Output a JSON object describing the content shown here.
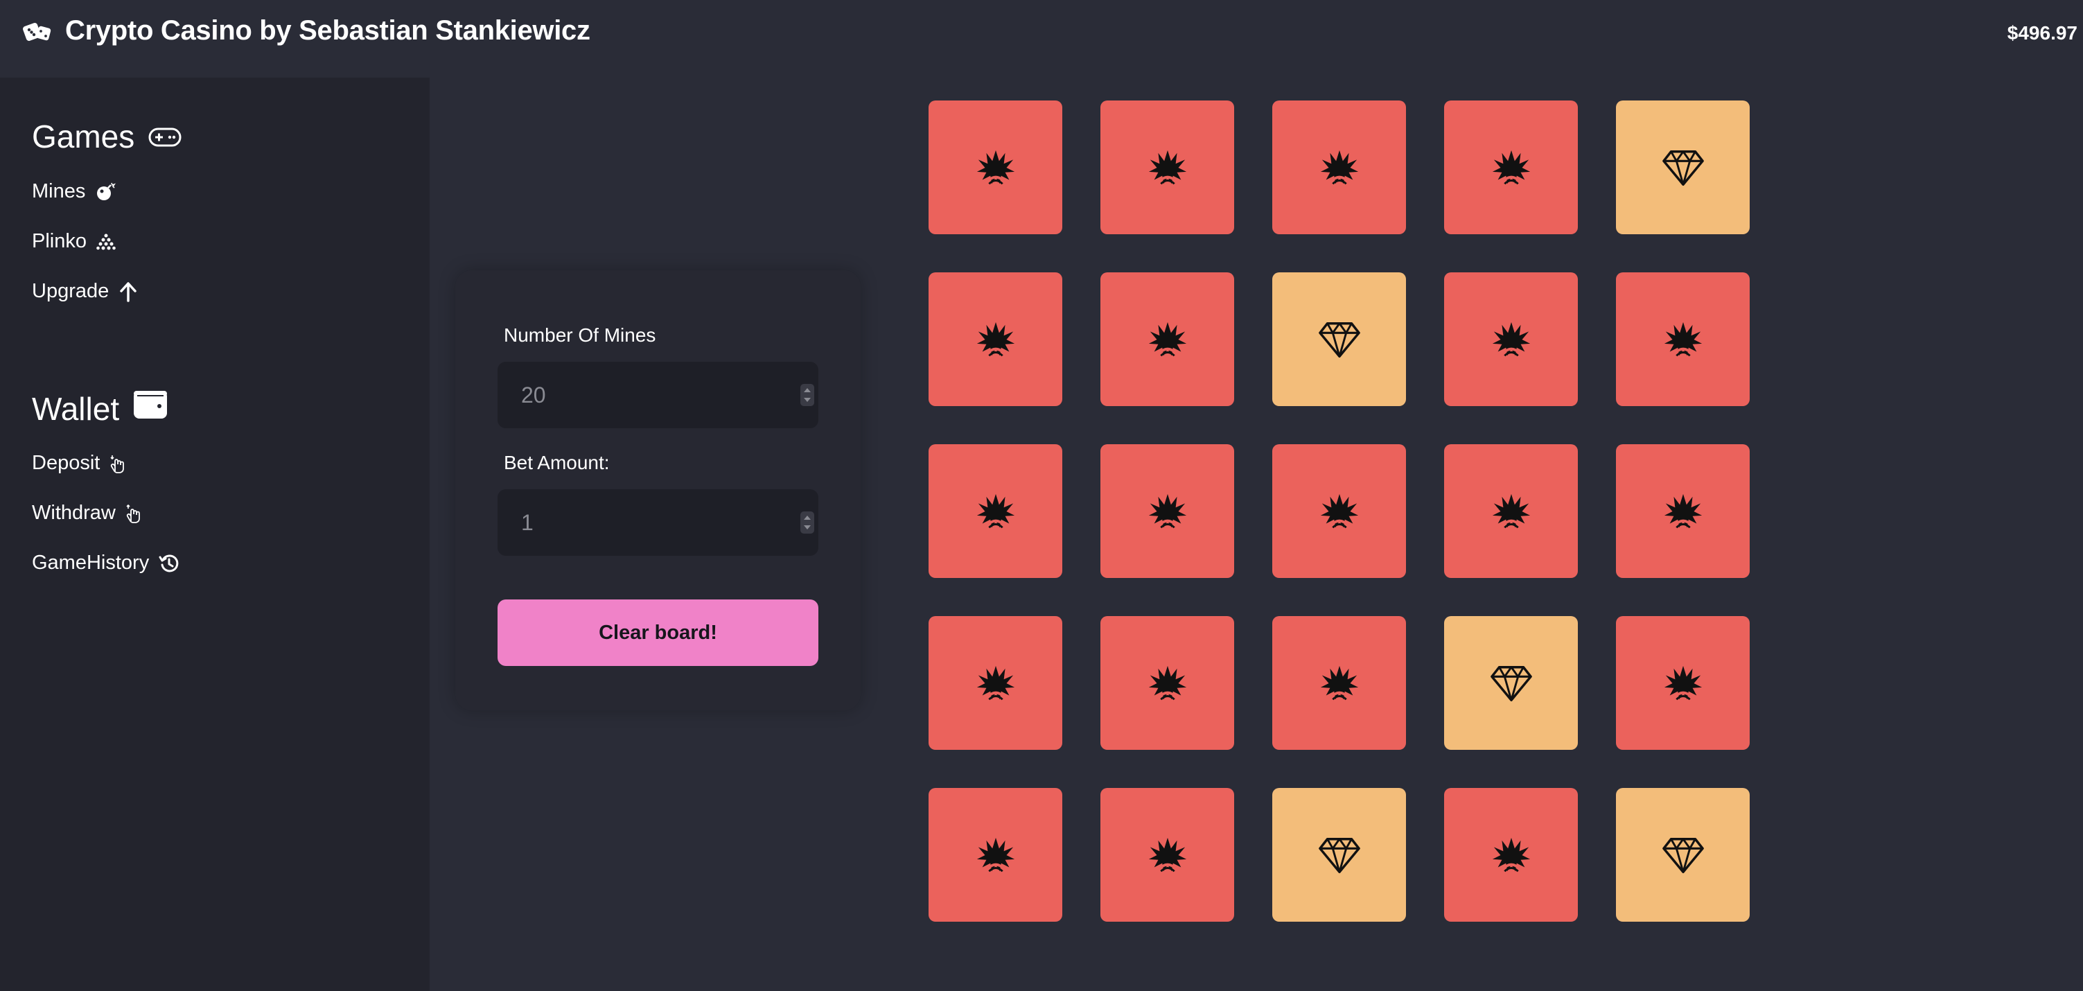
{
  "app": {
    "title": "Crypto Casino by Sebastian Stankiewicz",
    "balance": "$496.97",
    "brand_icon": "dice-icon"
  },
  "sidebar": {
    "games_heading": "Games",
    "games_icon": "gamepad-icon",
    "games": [
      {
        "label": "Mines",
        "icon": "bomb-icon"
      },
      {
        "label": "Plinko",
        "icon": "pyramid-icon"
      },
      {
        "label": "Upgrade",
        "icon": "arrow-up-icon"
      }
    ],
    "wallet_heading": "Wallet",
    "wallet_icon": "wallet-icon",
    "wallet": [
      {
        "label": "Deposit",
        "icon": "deposit-hand-icon"
      },
      {
        "label": "Withdraw",
        "icon": "withdraw-hand-icon"
      },
      {
        "label": "GameHistory",
        "icon": "history-icon"
      }
    ]
  },
  "controls": {
    "mines_label": "Number Of Mines",
    "mines_value": "20",
    "bet_label": "Bet Amount:",
    "bet_value": "1",
    "clear_button": "Clear board!"
  },
  "board": {
    "rows": [
      [
        "mine",
        "mine",
        "mine",
        "mine",
        "gem"
      ],
      [
        "mine",
        "mine",
        "gem",
        "mine",
        "mine"
      ],
      [
        "mine",
        "mine",
        "mine",
        "mine",
        "mine"
      ],
      [
        "mine",
        "mine",
        "mine",
        "gem",
        "mine"
      ],
      [
        "mine",
        "mine",
        "gem",
        "mine",
        "gem"
      ]
    ]
  },
  "colors": {
    "background": "#2a2c37",
    "sidebar": "#23242d",
    "mine_tile": "#eb625c",
    "gem_tile": "#f3bd7a",
    "clear_button": "#f082c8"
  }
}
